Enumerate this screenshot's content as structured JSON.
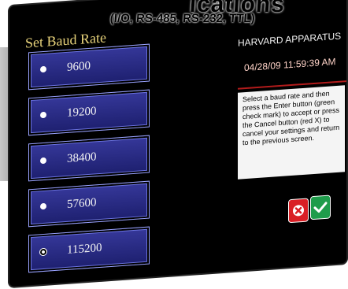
{
  "banner": {
    "heading_fragment": "ications",
    "subheading": "(I/O, RS-485, RS-232, TTL)"
  },
  "screen": {
    "title": "Set Baud Rate",
    "brand": "HARVARD APPARATUS",
    "datetime": "04/28/09 11:59:39 AM",
    "help_text": "Select a baud rate and then press the Enter button (green check mark) to accept or press the Cancel button (red X) to cancel your settings and return to the previous screen.",
    "baud_rates": [
      {
        "label": "9600",
        "selected": false
      },
      {
        "label": "19200",
        "selected": false
      },
      {
        "label": "38400",
        "selected": false
      },
      {
        "label": "57600",
        "selected": false
      },
      {
        "label": "115200",
        "selected": true
      }
    ],
    "colors": {
      "title": "#e7d27a",
      "button_bg": "#2a2d86",
      "cancel": "#d91f25",
      "ok": "#1f9c4b",
      "divider": "#b21b1b"
    },
    "icons": {
      "cancel": "close-icon",
      "ok": "check-icon"
    }
  }
}
